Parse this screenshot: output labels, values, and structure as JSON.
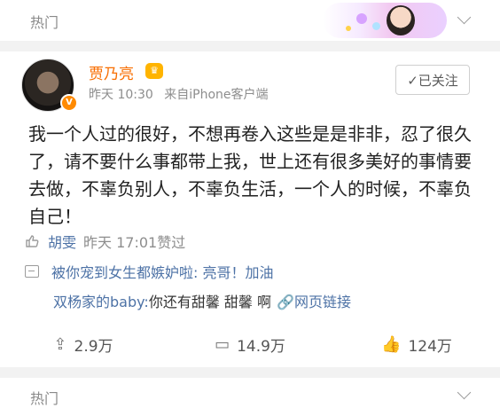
{
  "section": {
    "title": "热门"
  },
  "card": {
    "author": "贾乃亮",
    "meta": {
      "time": "昨天 10:30",
      "source": "来自iPhone客户端"
    },
    "follow_label": "✓已关注",
    "text": "我一个人过的很好，不想再卷入这些是是非非，忍了很久了，请不要什么事都带上我，世上还有很多美好的事情要去做，不辜负别人，不辜负生活，一个人的时候，不辜负自己！",
    "likes": {
      "name": "胡雯",
      "time": "昨天 17:01",
      "suffix": "赞过"
    },
    "comments": [
      {
        "text": "被你宠到女生都嫉妒啦: 亮哥！加油"
      },
      {
        "user": "双杨家的baby:",
        "text": " 你还有甜馨 甜馨 啊",
        "link": "网页链接"
      }
    ],
    "actions": {
      "repost": "2.9万",
      "comment": "14.9万",
      "like": "124万"
    }
  },
  "footer": {
    "title": "热门"
  },
  "colors": {
    "author": "#f86e00",
    "link": "#4d72a6",
    "muted": "#8d8d8d"
  },
  "icons": [
    "chevron-down-icon",
    "verified-badge-icon",
    "vip-crown-icon",
    "thumb-up-icon",
    "comment-icon",
    "repost-icon",
    "link-icon"
  ]
}
